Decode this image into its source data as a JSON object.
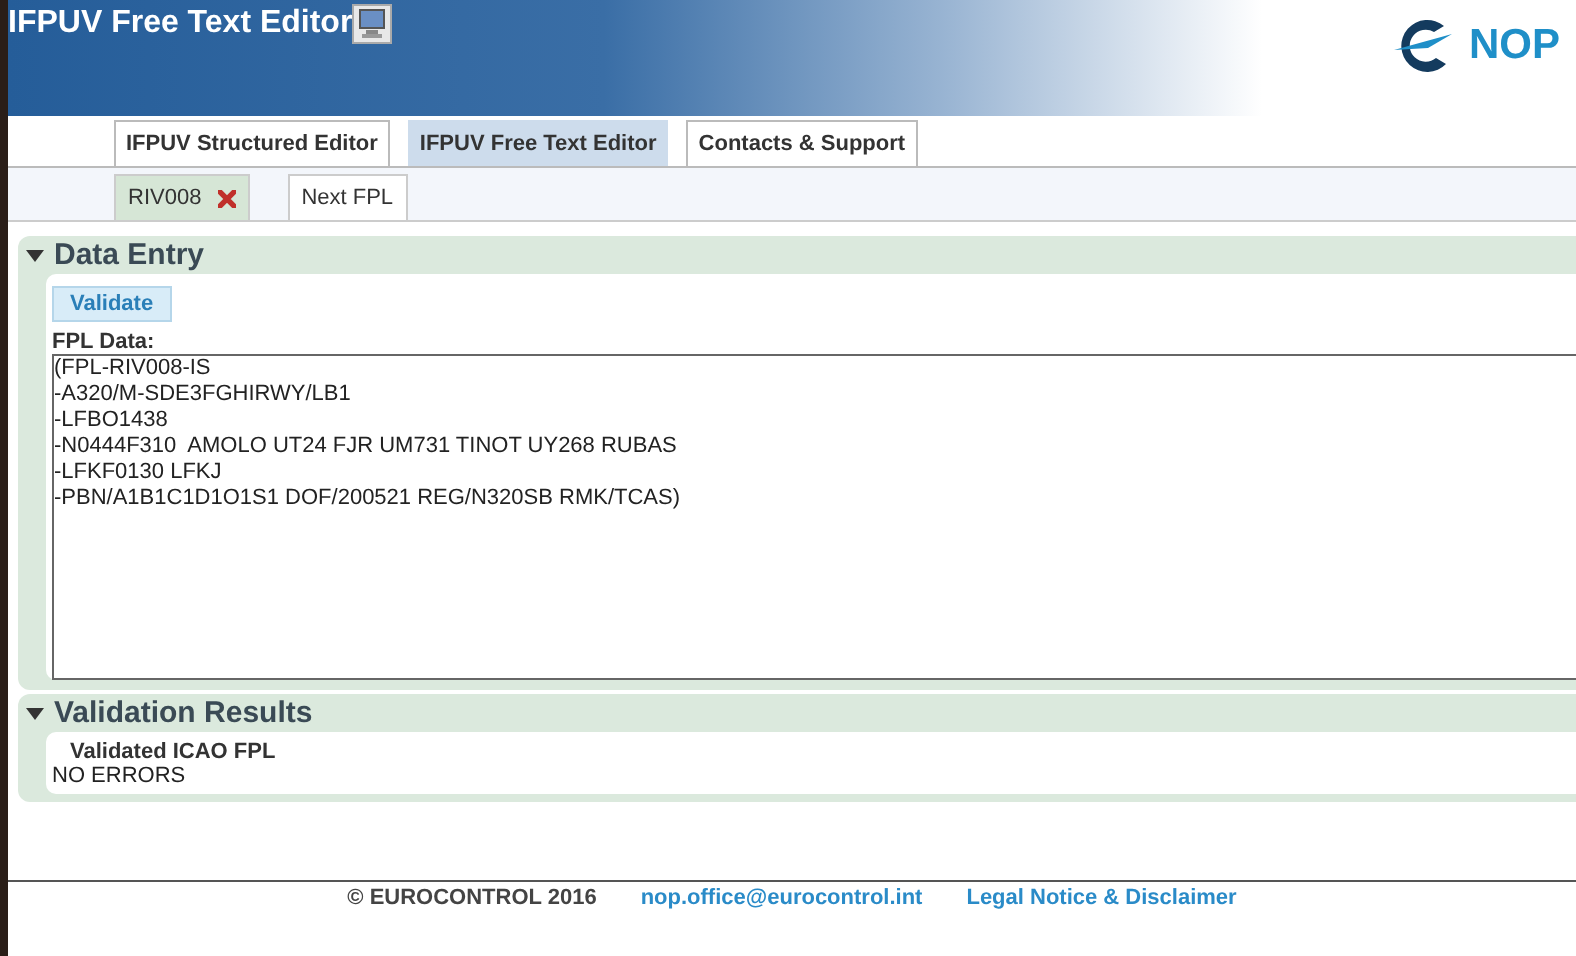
{
  "header": {
    "title": "IFPUV Free Text Editor",
    "logo_text": "NOP"
  },
  "nav_tabs": [
    {
      "label": "IFPUV Structured Editor",
      "selected": false
    },
    {
      "label": "IFPUV Free Text Editor",
      "selected": true
    },
    {
      "label": "Contacts & Support",
      "selected": false
    }
  ],
  "doc_tabs": [
    {
      "label": "RIV008",
      "selected": true,
      "closable": true
    },
    {
      "label": "Next FPL",
      "selected": false,
      "closable": false
    }
  ],
  "data_entry": {
    "title": "Data Entry",
    "expanded": true,
    "validate_button": "Validate",
    "field_label": "FPL Data:",
    "fpl_text": "(FPL-RIV008-IS\n-A320/M-SDE3FGHIRWY/LB1\n-LFBO1438\n-N0444F310  AMOLO UT24 FJR UM731 TINOT UY268 RUBAS\n-LFKF0130 LFKJ\n-PBN/A1B1C1D1O1S1 DOF/200521 REG/N320SB RMK/TCAS)"
  },
  "validation_results": {
    "title": "Validation Results",
    "expanded": true,
    "heading": "Validated ICAO FPL",
    "message": "NO ERRORS"
  },
  "footer": {
    "copyright": "© EUROCONTROL 2016",
    "email": "nop.office@eurocontrol.int",
    "legal": "Legal Notice & Disclaimer"
  }
}
